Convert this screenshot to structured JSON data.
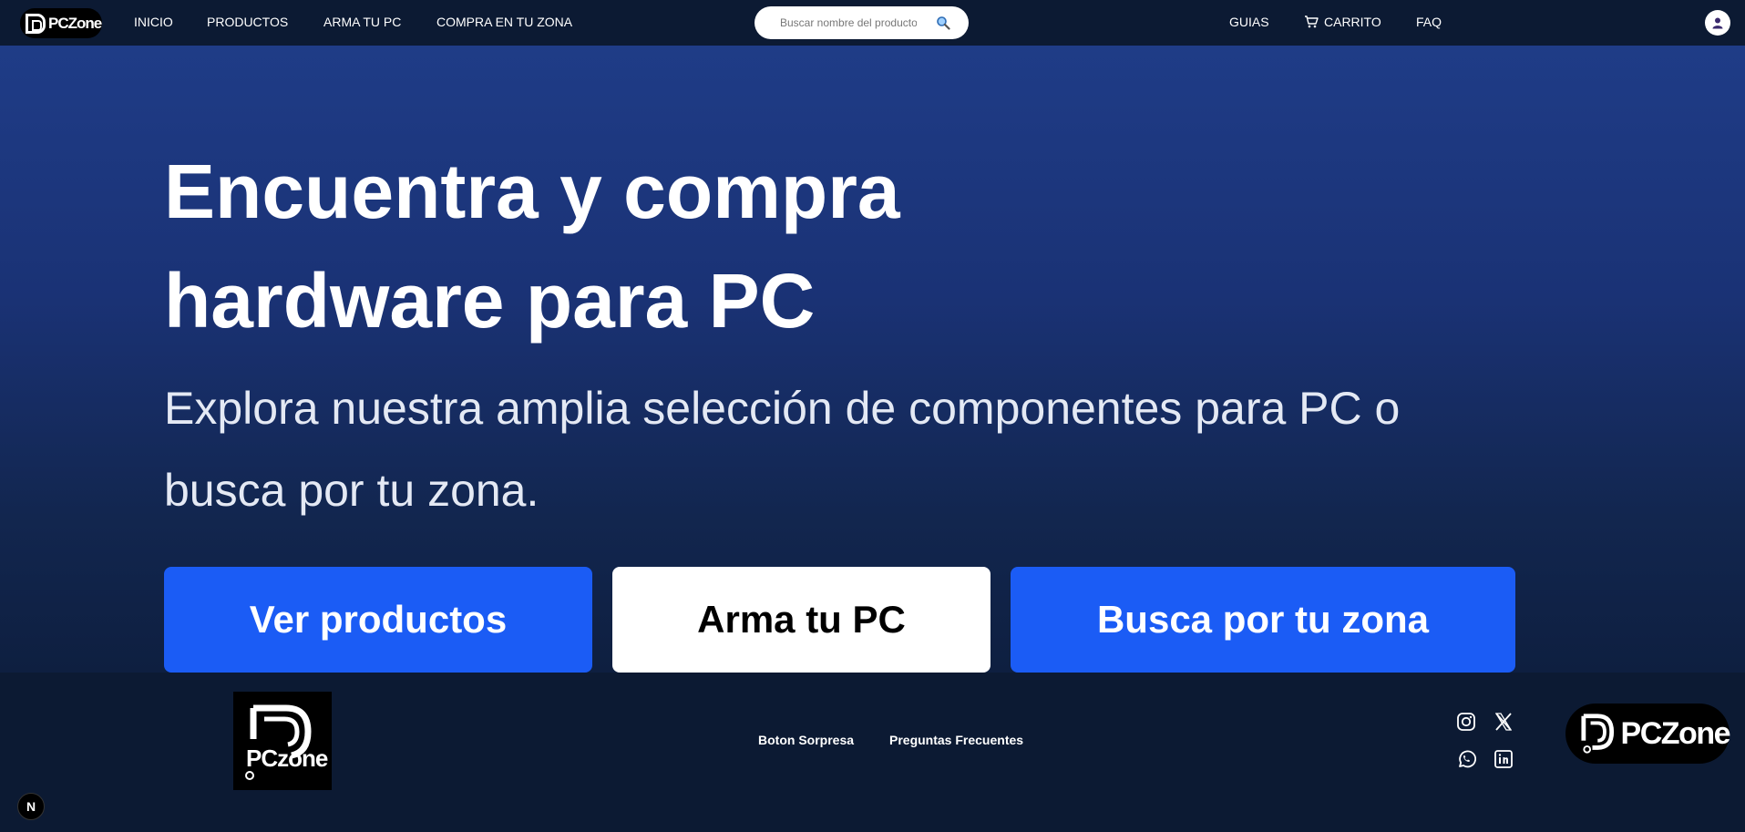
{
  "navbar": {
    "logo_text": "PCZone",
    "links": [
      "INICIO",
      "PRODUCTOS",
      "ARMA TU PC",
      "COMPRA EN TU ZONA"
    ],
    "search_placeholder": "Buscar nombre del producto",
    "search_value": "",
    "right_links": [
      "GUIAS",
      "CARRITO",
      "FAQ"
    ]
  },
  "hero": {
    "title": "Encuentra y compra hardware para PC",
    "subtitle": "Explora nuestra amplia selección de componentes para PC o busca por tu zona.",
    "buttons": [
      "Ver productos",
      "Arma tu PC",
      "Busca por tu zona"
    ]
  },
  "footer": {
    "logo_text": "PCzone",
    "links": [
      "Boton Sorpresa",
      "Preguntas Frecuentes"
    ],
    "socials": [
      "instagram-icon",
      "x-icon",
      "whatsapp-icon",
      "linkedin-icon"
    ],
    "badge_text": "PCZone"
  },
  "dev_badge": "N",
  "colors": {
    "nav_bg": "#0c1a33",
    "hero_top": "#1f3c87",
    "primary_button": "#1b5cf5",
    "footer_bg": "#0c1a33"
  }
}
